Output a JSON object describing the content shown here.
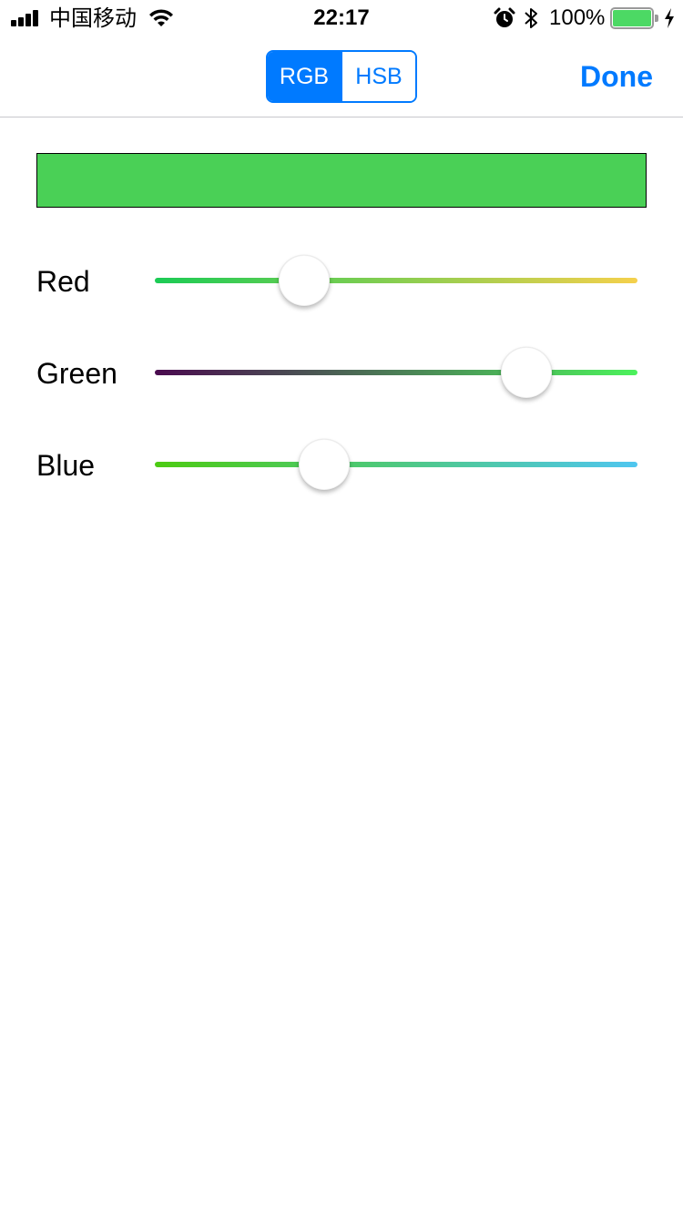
{
  "status_bar": {
    "carrier": "中国移动",
    "time": "22:17",
    "battery_percent": "100%",
    "icons": [
      "signal-icon",
      "wifi-icon",
      "alarm-icon",
      "bluetooth-icon",
      "battery-icon",
      "charging-icon"
    ]
  },
  "nav": {
    "segments": [
      {
        "label": "RGB",
        "selected": true
      },
      {
        "label": "HSB",
        "selected": false
      }
    ],
    "done_label": "Done",
    "accent_color": "#007aff"
  },
  "color_preview": {
    "color": "#4ad056"
  },
  "sliders": [
    {
      "label": "Red",
      "value": 0.31,
      "track_from": "#1bcb55",
      "track_to": "#f5d04c"
    },
    {
      "label": "Green",
      "value": 0.77,
      "track_from": "#4a0a4f",
      "track_to": "#4cf25c"
    },
    {
      "label": "Blue",
      "value": 0.35,
      "track_from": "#4ccb12",
      "track_to": "#4fc6f0"
    }
  ]
}
